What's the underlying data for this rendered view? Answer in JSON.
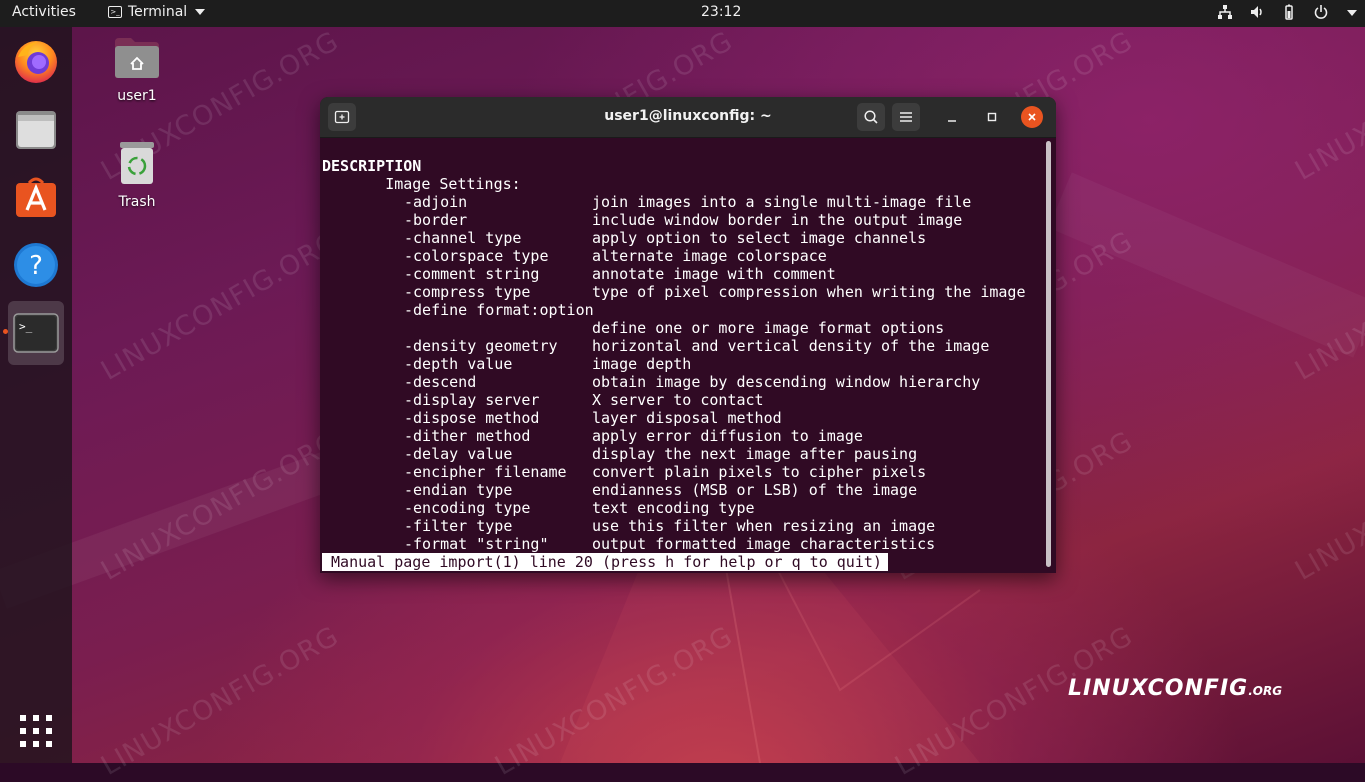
{
  "topbar": {
    "activities": "Activities",
    "app_name": "Terminal",
    "app_icon": "terminal-icon",
    "clock": "23:12",
    "tray_icons": [
      "network-icon",
      "speaker-icon",
      "battery-icon",
      "power-icon"
    ]
  },
  "dock": {
    "items": [
      {
        "name": "Firefox",
        "icon": "firefox-icon"
      },
      {
        "name": "Files",
        "icon": "files-icon"
      },
      {
        "name": "Ubuntu Software",
        "icon": "software-icon"
      },
      {
        "name": "Help",
        "icon": "help-icon"
      },
      {
        "name": "Terminal",
        "icon": "terminal-icon",
        "active": true
      },
      {
        "name": "Show Applications",
        "icon": "app-grid-icon"
      }
    ],
    "terminal_glyph": ">_",
    "help_glyph": "?"
  },
  "desktop": {
    "icons": [
      {
        "label": "user1",
        "icon": "home-folder-icon"
      },
      {
        "label": "Trash",
        "icon": "trash-icon"
      }
    ],
    "watermark": "LINUXCONFIG.ORG",
    "logo": {
      "main": "LINUXCONFIG",
      "suffix": ".ORG"
    }
  },
  "terminal": {
    "title": "user1@linuxconfig: ~",
    "section": "DESCRIPTION",
    "subsection": "       Image Settings:",
    "options": [
      {
        "opt": "-adjoin",
        "desc": "join images into a single multi-image file"
      },
      {
        "opt": "-border",
        "desc": "include window border in the output image"
      },
      {
        "opt": "-channel type",
        "desc": "apply option to select image channels"
      },
      {
        "opt": "-colorspace type",
        "desc": "alternate image colorspace"
      },
      {
        "opt": "-comment string",
        "desc": "annotate image with comment"
      },
      {
        "opt": "-compress type",
        "desc": "type of pixel compression when writing the image"
      },
      {
        "opt": "-define format:option",
        "desc": ""
      },
      {
        "opt": "",
        "desc": "define one or more image format options"
      },
      {
        "opt": "-density geometry",
        "desc": "horizontal and vertical density of the image"
      },
      {
        "opt": "-depth value",
        "desc": "image depth"
      },
      {
        "opt": "-descend",
        "desc": "obtain image by descending window hierarchy"
      },
      {
        "opt": "-display server",
        "desc": "X server to contact"
      },
      {
        "opt": "-dispose method",
        "desc": "layer disposal method"
      },
      {
        "opt": "-dither method",
        "desc": "apply error diffusion to image"
      },
      {
        "opt": "-delay value",
        "desc": "display the next image after pausing"
      },
      {
        "opt": "-encipher filename",
        "desc": "convert plain pixels to cipher pixels"
      },
      {
        "opt": "-endian type",
        "desc": "endianness (MSB or LSB) of the image"
      },
      {
        "opt": "-encoding type",
        "desc": "text encoding type"
      },
      {
        "opt": "-filter type",
        "desc": "use this filter when resizing an image"
      },
      {
        "opt": "-format \"string\"",
        "desc": "output formatted image characteristics"
      }
    ],
    "status": " Manual page import(1) line 20 (press h for help or q to quit)"
  }
}
